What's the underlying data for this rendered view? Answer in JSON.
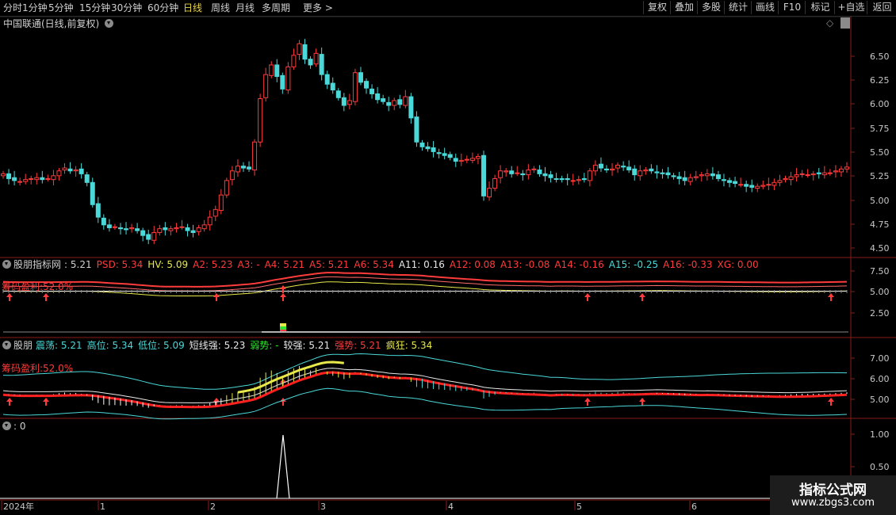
{
  "toolbar": {
    "tabs": [
      "分时",
      "1分钟",
      "5分钟",
      "15分钟",
      "30分钟",
      "60分钟",
      "日线",
      "周线",
      "月线",
      "多周期",
      "更多 >"
    ],
    "active_index": 6,
    "right_buttons": [
      "复权",
      "叠加",
      "多股",
      "统计",
      "画线",
      "F10",
      "标记",
      "+自选",
      "返回"
    ]
  },
  "main_panel": {
    "title": "中国联通(日线,前复权)",
    "price_ticks": [
      "6.50",
      "6.25",
      "6.00",
      "5.75",
      "5.50",
      "5.25",
      "5.00",
      "4.75",
      "4.50"
    ]
  },
  "ind1": {
    "name": "股朋指标网",
    "values": [
      {
        "t": ": 5.21",
        "c": "#d0d0d0"
      },
      {
        "t": "PSD: 5.34",
        "c": "#ff3b3b"
      },
      {
        "t": "HV: 5.09",
        "c": "#e8e84a"
      },
      {
        "t": "A2: 5.23",
        "c": "#ff3b3b"
      },
      {
        "t": "A3: -",
        "c": "#ff3b3b"
      },
      {
        "t": "A4: 5.21",
        "c": "#ff3b3b"
      },
      {
        "t": "A5: 5.21",
        "c": "#ff3b3b"
      },
      {
        "t": "A6: 5.34",
        "c": "#ff3b3b"
      },
      {
        "t": "A11: 0.16",
        "c": "#e8e8e8"
      },
      {
        "t": "A12: 0.08",
        "c": "#ff3b3b"
      },
      {
        "t": "A13: -0.08",
        "c": "#ff3b3b"
      },
      {
        "t": "A14: -0.16",
        "c": "#ff3b3b"
      },
      {
        "t": "A15: -0.25",
        "c": "#4ad8d8"
      },
      {
        "t": "A16: -0.33",
        "c": "#ff3b3b"
      },
      {
        "t": "XG: 0.00",
        "c": "#ff3b3b"
      }
    ],
    "label": "筹码盈利:52.0%",
    "ticks": [
      "7.50",
      "5.00",
      "2.50"
    ]
  },
  "ind2": {
    "name": "股朋",
    "values": [
      {
        "t": "震荡: 5.21",
        "c": "#4ad8d8"
      },
      {
        "t": "高位: 5.34",
        "c": "#4ad8d8"
      },
      {
        "t": "低位: 5.09",
        "c": "#4ad8d8"
      },
      {
        "t": "短线强: 5.23",
        "c": "#e8e8e8"
      },
      {
        "t": "弱势: -",
        "c": "#2ee62e"
      },
      {
        "t": "较强: 5.21",
        "c": "#e8e8e8"
      },
      {
        "t": "强势: 5.21",
        "c": "#ff3b3b"
      },
      {
        "t": "疯狂: 5.34",
        "c": "#e8e84a"
      }
    ],
    "label": "筹码盈利:52.0%",
    "ticks": [
      "7.00",
      "6.00",
      "5.00"
    ]
  },
  "ind3": {
    "name": ": 0",
    "ticks": [
      "1.00",
      "0.50"
    ]
  },
  "date_axis": [
    "2024年",
    "1",
    "2",
    "3",
    "4",
    "5",
    "6"
  ],
  "watermark": {
    "line1": "指标公式网",
    "line2": "www.zbgs3.com"
  },
  "colors": {
    "up": "#ff3b3b",
    "down": "#4ad8d8",
    "grid": "#8b1a1a",
    "text": "#c8c8c8"
  }
}
